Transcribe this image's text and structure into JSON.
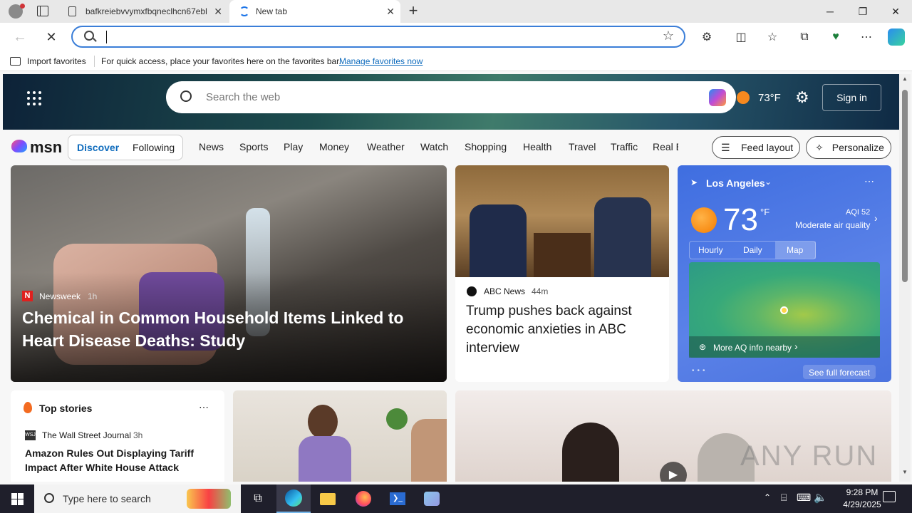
{
  "tabs": [
    {
      "title": "bafkreiebvvymxfbqneclhcn67ebl"
    },
    {
      "title": "New tab"
    }
  ],
  "favorites_bar": {
    "import_label": "Import favorites",
    "hint": "For quick access, place your favorites here on the favorites bar.",
    "manage_link": "Manage favorites now"
  },
  "hero": {
    "search_placeholder": "Search the web",
    "temperature": "73°F",
    "sign_in": "Sign in"
  },
  "nav": {
    "brand": "msn",
    "discover": "Discover",
    "following": "Following",
    "items": [
      "News",
      "Sports",
      "Play",
      "Money",
      "Weather",
      "Watch",
      "Shopping",
      "Health",
      "Travel",
      "Traffic",
      "Real E"
    ],
    "feed_layout": "Feed layout",
    "personalize": "Personalize"
  },
  "hero_story": {
    "source": "Newsweek",
    "time": "1h",
    "title": "Chemical in Common Household Items Linked to Heart Disease Deaths: Study"
  },
  "story2": {
    "source": "ABC News",
    "time": "44m",
    "title": "Trump pushes back against economic anxieties in ABC interview"
  },
  "weather": {
    "location": "Los Angeles",
    "temp": "73",
    "unit": "°F",
    "aqi": "AQI 52",
    "aqi_text": "Moderate air quality",
    "tabs": [
      "Hourly",
      "Daily",
      "Map"
    ],
    "more_aq": "More AQ info nearby",
    "see_forecast": "See full forecast"
  },
  "top_stories": {
    "heading": "Top stories",
    "source": "The Wall Street Journal",
    "time": "3h",
    "title": "Amazon Rules Out Displaying Tariff Impact After White House Attack"
  },
  "taskbar": {
    "search_placeholder": "Type here to search",
    "time": "9:28 PM",
    "date": "4/29/2025"
  },
  "watermark": "ANY RUN",
  "colors": {
    "accent": "#0f6cbd",
    "nav_active": "#0f6cbd",
    "taskbar": "#1f1f2b"
  }
}
